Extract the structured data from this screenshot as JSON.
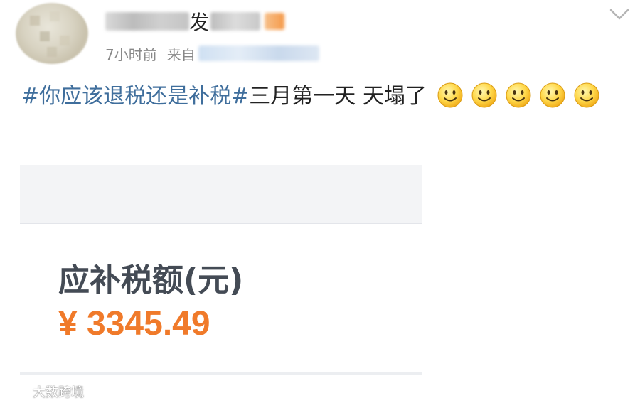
{
  "post": {
    "username_visible": "发",
    "time": "7小时前",
    "source_prefix": "来自",
    "topic": "#你应该退税还是补税#",
    "text": "三月第一天 天塌了",
    "emoji_count": 5,
    "emoji_icon": "smile-icon",
    "more_icon": "chevron-down-icon"
  },
  "card": {
    "label": "应补税额(元)",
    "amount": "¥ 3345.49"
  },
  "watermark": {
    "text": "大数跨境"
  },
  "colors": {
    "topic": "#3f6e9c",
    "amount": "#f07a2a",
    "label": "#444b55",
    "meta": "#888888"
  }
}
